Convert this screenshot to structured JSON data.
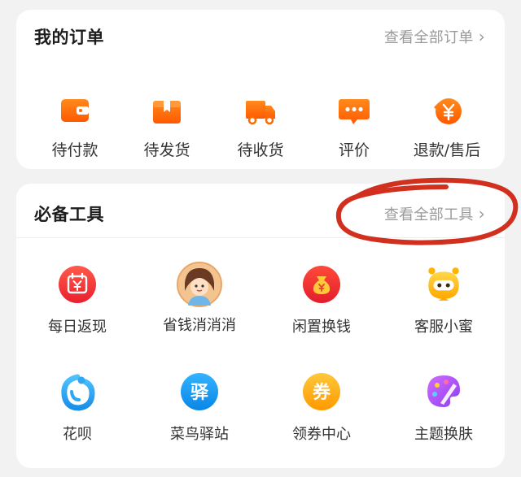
{
  "orders": {
    "title": "我的订单",
    "view_all": "查看全部订单",
    "items": [
      {
        "label": "待付款",
        "icon": "wallet-icon"
      },
      {
        "label": "待发货",
        "icon": "package-icon"
      },
      {
        "label": "待收货",
        "icon": "truck-icon"
      },
      {
        "label": "评价",
        "icon": "comment-icon"
      },
      {
        "label": "退款/售后",
        "icon": "refund-icon"
      }
    ]
  },
  "tools": {
    "title": "必备工具",
    "view_all": "查看全部工具",
    "items": [
      {
        "label": "每日返现",
        "icon": "daily-cashback-icon"
      },
      {
        "label": "省钱消消消",
        "icon": "avatar-game-icon"
      },
      {
        "label": "闲置换钱",
        "icon": "money-bag-icon"
      },
      {
        "label": "客服小蜜",
        "icon": "service-robot-icon"
      },
      {
        "label": "花呗",
        "icon": "huabei-icon"
      },
      {
        "label": "菜鸟驿站",
        "icon": "cainiao-icon",
        "glyph": "驿"
      },
      {
        "label": "领券中心",
        "icon": "coupon-icon",
        "glyph": "券"
      },
      {
        "label": "主题换肤",
        "icon": "palette-icon"
      }
    ]
  },
  "colors": {
    "accent": "#ff6a00",
    "annotation": "#d2301f",
    "text_secondary": "#9a9a9a"
  }
}
